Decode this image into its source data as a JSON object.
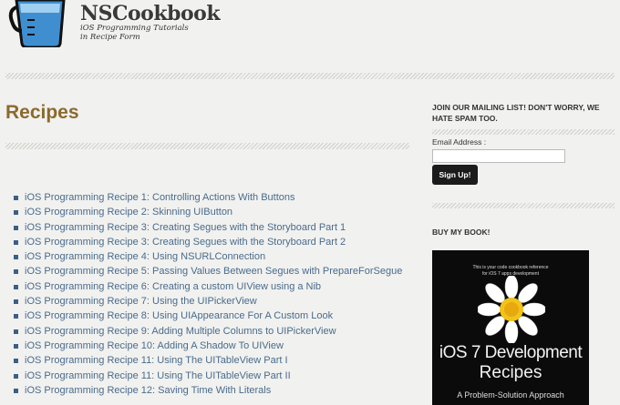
{
  "site": {
    "title": "NSCookbook",
    "tagline_line1": "iOS Programming Tutorials",
    "tagline_line2": "in Recipe Form"
  },
  "main": {
    "page_title": "Recipes",
    "recipes": [
      "iOS Programming Recipe 1: Controlling Actions With Buttons",
      "iOS Programming Recipe 2: Skinning UIButton",
      "iOS Programming Recipe 3: Creating Segues with the Storyboard Part 1",
      "iOS Programming Recipe 3: Creating Segues with the Storyboard Part 2",
      "iOS Programming Recipe 4: Using NSURLConnection",
      "iOS Programming Recipe 5: Passing Values Between Segues with PrepareForSegue",
      "iOS Programming Recipe 6: Creating a custom UIView using a Nib",
      "iOS Programming Recipe 7: Using the UIPickerView",
      "iOS Programming Recipe 8: Using UIAppearance For A Custom Look",
      "iOS Programming Recipe 9: Adding Multiple Columns to UIPickerView",
      "iOS Programming Recipe 10: Adding A Shadow To UIView",
      "iOS Programming Recipe 11: Using The UITableView Part I",
      "iOS Programming Recipe 11: Using The UITableView Part II",
      "iOS Programming Recipe 12: Saving Time With Literals"
    ]
  },
  "sidebar": {
    "mailing_heading": "Join our mailing list! Don't worry, we hate spam too.",
    "email_label": "Email Address :",
    "email_value": "",
    "signup_label": "Sign Up!",
    "book_heading": "Buy my book!",
    "book": {
      "blurb_line1": "This is your code cookbook reference",
      "blurb_line2": "for iOS 7 apps development",
      "title_line1": "iOS 7 Development",
      "title_line2": "Recipes",
      "subtitle": "A Problem-Solution Approach"
    }
  },
  "colors": {
    "page_title": "#8c6a2d",
    "link": "#4a6b8c",
    "background": "#f1f1ef"
  }
}
